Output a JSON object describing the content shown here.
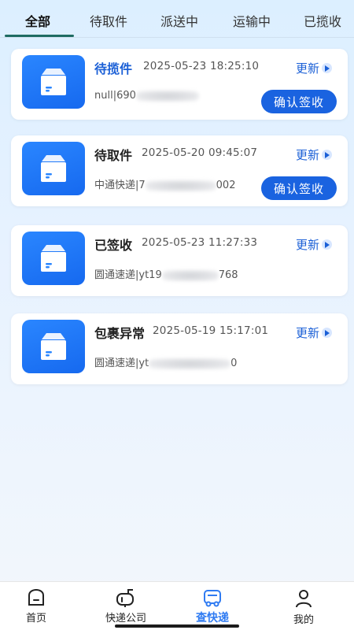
{
  "tabs": [
    {
      "label": "全部",
      "active": true
    },
    {
      "label": "待取件",
      "active": false
    },
    {
      "label": "派送中",
      "active": false
    },
    {
      "label": "运输中",
      "active": false
    },
    {
      "label": "已揽收",
      "active": false
    }
  ],
  "cards": [
    {
      "status": "待揽件",
      "time": "2025-05-23 18:25:10",
      "update": "更新",
      "tracking_prefix": "null|690",
      "tracking_suffix": "",
      "button": "确认签收"
    },
    {
      "status": "待取件",
      "time": "2025-05-20 09:45:07",
      "update": "更新",
      "tracking_prefix": "中通快递|7",
      "tracking_suffix": "002",
      "button": "确认签收"
    },
    {
      "status": "已签收",
      "time": "2025-05-23 11:27:33",
      "update": "更新",
      "tracking_prefix": "圆通速递|yt19",
      "tracking_suffix": "768",
      "button": ""
    },
    {
      "status": "包裹异常",
      "time": "2025-05-19 15:17:01",
      "update": "更新",
      "tracking_prefix": "圆通速递|yt",
      "tracking_suffix": "0",
      "button": ""
    }
  ],
  "nav": [
    {
      "label": "首页",
      "icon": "home-icon",
      "active": false
    },
    {
      "label": "快递公司",
      "icon": "mailbox-icon",
      "active": false
    },
    {
      "label": "查快递",
      "icon": "truck-icon",
      "active": true
    },
    {
      "label": "我的",
      "icon": "user-icon",
      "active": false
    }
  ],
  "colors": {
    "accent": "#1a63e0",
    "icon_bg": "#1f74f5",
    "nav_active": "#2f7bf2",
    "update_text": "#1a5fd6"
  }
}
